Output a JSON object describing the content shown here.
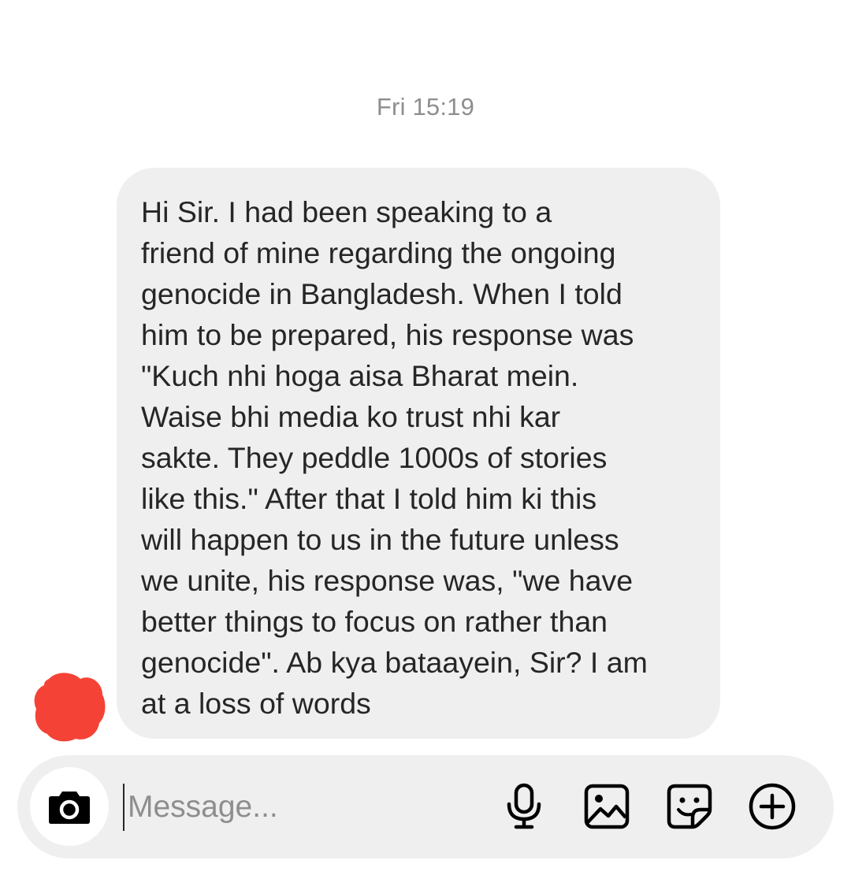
{
  "thread": {
    "timestamp": "Fri 15:19",
    "message": "Hi Sir. I had been speaking to a\nfriend of mine regarding the ongoing\ngenocide in Bangladesh. When I told\nhim to be prepared, his response was\n\"Kuch nhi hoga aisa Bharat mein.\nWaise bhi media ko trust nhi kar\nsakte. They peddle 1000s of stories\nlike this.\" After that I told him ki this\nwill happen to us in the future unless\nwe unite, his response was, \"we have\nbetter things to focus on rather than\ngenocide\". Ab kya bataayein, Sir? I am\nat a loss of words"
  },
  "composer": {
    "placeholder": "Message...",
    "value": "",
    "icons": [
      "camera-icon",
      "microphone-icon",
      "gallery-icon",
      "sticker-icon",
      "plus-circle-icon"
    ]
  },
  "colors": {
    "bubble": "#efefef",
    "text": "#262626",
    "muted": "#8e8e8e",
    "avatar_redaction": "#f44336"
  }
}
